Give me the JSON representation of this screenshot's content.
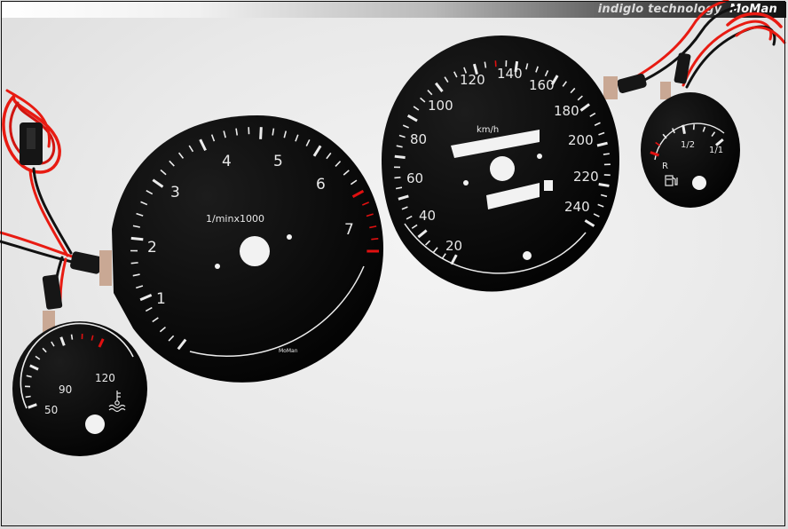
{
  "header": {
    "tagline": "indiglo technology",
    "logo_text": "MoMan"
  },
  "colors": {
    "dial_face": "#060606",
    "markings": "#ececec",
    "redline": "#e01010",
    "wire_red": "#e81b12",
    "wire_black": "#111111"
  },
  "tachometer": {
    "unit_label": "1/minx1000",
    "numbers": [
      "1",
      "2",
      "3",
      "4",
      "5",
      "6",
      "7"
    ],
    "maker_mark": "MoMan"
  },
  "speedometer": {
    "unit_label": "km/h",
    "numbers": [
      "20",
      "40",
      "60",
      "80",
      "100",
      "120",
      "140",
      "160",
      "180",
      "200",
      "220",
      "240"
    ]
  },
  "temperature_gauge": {
    "numbers": [
      "50",
      "90",
      "120"
    ],
    "icon": "coolant-temperature-icon"
  },
  "fuel_gauge": {
    "labels": [
      "R",
      "1/2",
      "1/1"
    ],
    "icon": "fuel-pump-icon"
  }
}
